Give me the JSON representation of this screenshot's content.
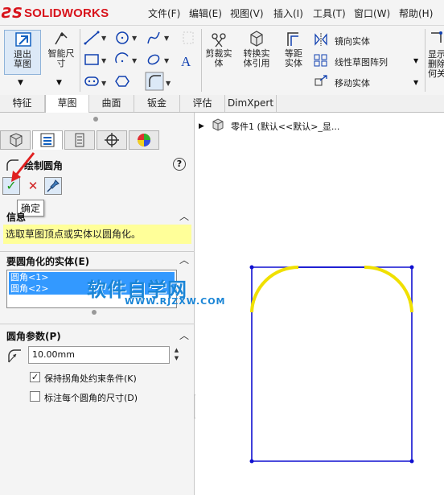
{
  "app": {
    "brand": "SOLIDWORKS"
  },
  "menu": [
    "文件(F)",
    "编辑(E)",
    "视图(V)",
    "插入(I)",
    "工具(T)",
    "窗口(W)",
    "帮助(H)"
  ],
  "toolbar": {
    "exit_sketch": "退出草图",
    "smart_dim": "智能尺寸",
    "trim": "剪裁实体",
    "convert": "转换实体引用",
    "offset": "等距实体",
    "mirror": "镜向实体",
    "linear_pattern": "线性草图阵列",
    "move": "移动实体",
    "right_cut": "显示/删除几何关系"
  },
  "tabs": [
    "特征",
    "草图",
    "曲面",
    "钣金",
    "评估",
    "DimXpert"
  ],
  "active_tab": 1,
  "property_manager": {
    "title": "绘制圆角",
    "ok_tooltip": "确定",
    "message_header": "信息",
    "message": "选取草图顶点或实体以圆角化。",
    "entities_header": "要圆角化的实体(E)",
    "entities": [
      "圆角<1>",
      "圆角<2>"
    ],
    "params_header": "圆角参数(P)",
    "radius": "10.00mm",
    "keep_constrained": "保持拐角处约束条件(K)",
    "keep_constrained_checked": true,
    "dim_each": "标注每个圆角的尺寸(D)",
    "dim_each_checked": false
  },
  "feature_tree": {
    "part": "零件1  (默认<<默认>_显..."
  },
  "watermark": {
    "title": "软件自学网",
    "url": "WWW.RJZXW.COM"
  },
  "colors": {
    "sketch_line": "#1010d0",
    "fillet_highlight": "#f0e000",
    "brand_red": "#d8131b"
  }
}
